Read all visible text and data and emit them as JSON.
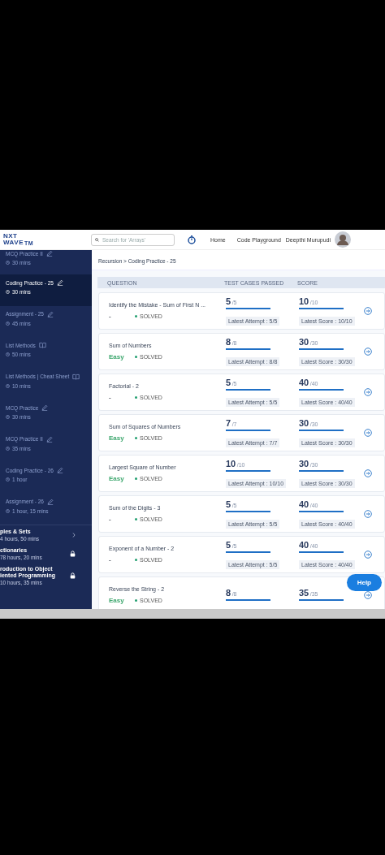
{
  "header": {
    "logo": [
      "NXT",
      "WAVE"
    ],
    "logo_mark": "TM",
    "search": {
      "placeholder": "Search for 'Arrays'"
    },
    "nav": [
      "Home",
      "Code Playground"
    ],
    "user": "Deepthi Murupudi"
  },
  "sidebar": {
    "items": [
      {
        "title": "MCQ Practice II",
        "duration": "30 mins",
        "kind": "edit",
        "selected": false
      },
      {
        "title": "Coding Practice - 25",
        "duration": "30 mins",
        "kind": "edit",
        "selected": true
      },
      {
        "title": "Assignment - 25",
        "duration": "45 mins",
        "kind": "edit",
        "selected": false
      },
      {
        "title": "List Methods",
        "duration": "50 mins",
        "kind": "book",
        "selected": false
      },
      {
        "title": "List Methods | Cheat Sheet",
        "duration": "10 mins",
        "kind": "book",
        "selected": false
      },
      {
        "title": "MCQ Practice",
        "duration": "30 mins",
        "kind": "edit",
        "selected": false
      },
      {
        "title": "MCQ Practice II",
        "duration": "35 mins",
        "kind": "edit",
        "selected": false
      },
      {
        "title": "Coding Practice - 26",
        "duration": "1 hour",
        "kind": "edit",
        "selected": false
      },
      {
        "title": "Assignment - 26",
        "duration": "1 hour, 15 mins",
        "kind": "edit",
        "selected": false
      }
    ],
    "modules": [
      {
        "title": "ples & Sets",
        "duration": "4 hours, 50 mins",
        "locked": false
      },
      {
        "title": "ctionaries",
        "duration": "78 hours, 20 mins",
        "locked": true
      },
      {
        "title": "roduction to Object iented Programming",
        "duration": "10 hours, 35 mins",
        "locked": true
      }
    ]
  },
  "breadcrumb": "Recursion > Coding Practice - 25",
  "table": {
    "columns": [
      "QUESTION",
      "TEST CASES PASSED",
      "SCORE"
    ],
    "rows": [
      {
        "title": "Identify the Mistake - Sum of First N ...",
        "difficulty": {
          "text": "-"
        },
        "status": "SOLVED",
        "test_cases": {
          "count": "5",
          "total": "/5",
          "level": 1,
          "latest": "Latest Attempt : 5/5"
        },
        "score": {
          "count": "10",
          "total": "/10",
          "level": 1,
          "latest": "Latest Score : 10/10"
        }
      },
      {
        "title": "Sum of Numbers",
        "difficulty": {
          "text": "Easy",
          "color": "#3fa86f"
        },
        "status": "SOLVED",
        "test_cases": {
          "count": "8",
          "total": "/8",
          "level": 1,
          "latest": "Latest Attempt : 8/8"
        },
        "score": {
          "count": "30",
          "total": "/30",
          "level": 1,
          "latest": "Latest Score : 30/30"
        }
      },
      {
        "title": "Factorial - 2",
        "difficulty": {
          "text": "-"
        },
        "status": "SOLVED",
        "test_cases": {
          "count": "5",
          "total": "/5",
          "level": 1,
          "latest": "Latest Attempt : 5/5"
        },
        "score": {
          "count": "40",
          "total": "/40",
          "level": 1,
          "latest": "Latest Score : 40/40"
        }
      },
      {
        "title": "Sum of Squares of Numbers",
        "difficulty": {
          "text": "Easy",
          "color": "#3fa86f"
        },
        "status": "SOLVED",
        "test_cases": {
          "count": "7",
          "total": "/7",
          "level": 1,
          "latest": "Latest Attempt : 7/7"
        },
        "score": {
          "count": "30",
          "total": "/30",
          "level": 1,
          "latest": "Latest Score : 30/30"
        }
      },
      {
        "title": "Largest Square of Number",
        "difficulty": {
          "text": "Easy",
          "color": "#3fa86f"
        },
        "status": "SOLVED",
        "test_cases": {
          "count": "10",
          "total": "/10",
          "level": 1,
          "latest": "Latest Attempt : 10/10"
        },
        "score": {
          "count": "30",
          "total": "/30",
          "level": 1,
          "latest": "Latest Score : 30/30"
        }
      },
      {
        "title": "Sum of the Digits - 3",
        "difficulty": {
          "text": "-"
        },
        "status": "SOLVED",
        "test_cases": {
          "count": "5",
          "total": "/5",
          "level": 1,
          "latest": "Latest Attempt : 5/5"
        },
        "score": {
          "count": "40",
          "total": "/40",
          "level": 1,
          "latest": "Latest Score : 40/40"
        }
      },
      {
        "title": "Exponent of a Number - 2",
        "difficulty": {
          "text": "-"
        },
        "status": "SOLVED",
        "test_cases": {
          "count": "5",
          "total": "/5",
          "level": 1,
          "latest": "Latest Attempt : 5/5"
        },
        "score": {
          "count": "40",
          "total": "/40",
          "level": 1,
          "latest": "Latest Score : 40/40"
        }
      },
      {
        "title": "Reverse the String - 2",
        "difficulty": {
          "text": "Easy",
          "color": "#3fa86f"
        },
        "status": "SOLVED",
        "test_cases": {
          "count": "8",
          "total": "/8",
          "level": 1
        },
        "score": {
          "count": "35",
          "total": "/35",
          "level": 1
        }
      }
    ]
  },
  "help": "Help"
}
